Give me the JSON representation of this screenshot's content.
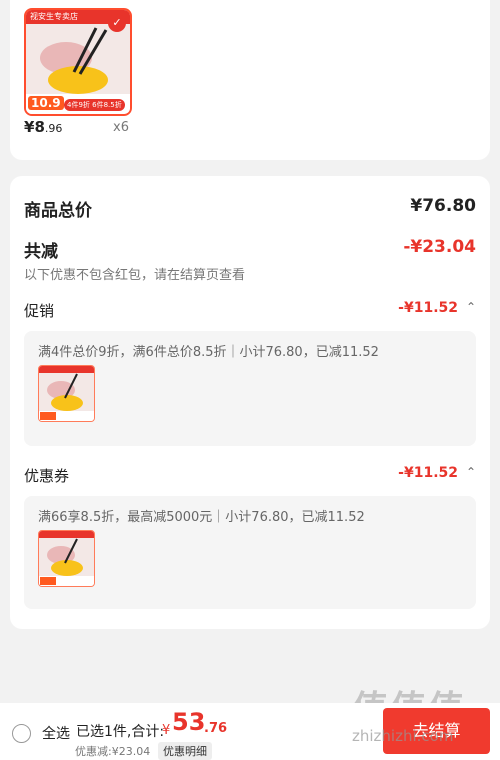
{
  "product": {
    "shop_label": "视安生专卖店",
    "price_symbol": "¥",
    "price_int": "8",
    "price_dec": ".96",
    "quantity": "x6",
    "image_price": "10.9",
    "image_badge": "4件9折 6件8.5折"
  },
  "summary": {
    "total_label": "商品总价",
    "total_value": "¥76.80",
    "discount_label": "共减",
    "discount_value": "-¥23.04",
    "note": "以下优惠不包含红包，请在结算页查看"
  },
  "promotion": {
    "label": "促销",
    "value": "-¥11.52",
    "detail": "满4件总价9折，满6件总价8.5折｜小计76.80，已减11.52"
  },
  "coupon": {
    "label": "优惠券",
    "value": "-¥11.52",
    "detail": "满66享8.5折，最高减5000元｜小计76.80，已减11.52"
  },
  "bottom": {
    "select_all": "全选",
    "selected": "已选1件,合计:",
    "total_symbol": "¥",
    "total_int": "53",
    "total_dec": ".76",
    "discount_text": "优惠减:¥23.04",
    "detail_button": "优惠明细",
    "checkout": "去结算"
  },
  "watermark": {
    "text": "值值值",
    "site": "zhizhizhi.com"
  },
  "colors": {
    "accent": "#e8342b",
    "checkout": "#f03a2e"
  }
}
